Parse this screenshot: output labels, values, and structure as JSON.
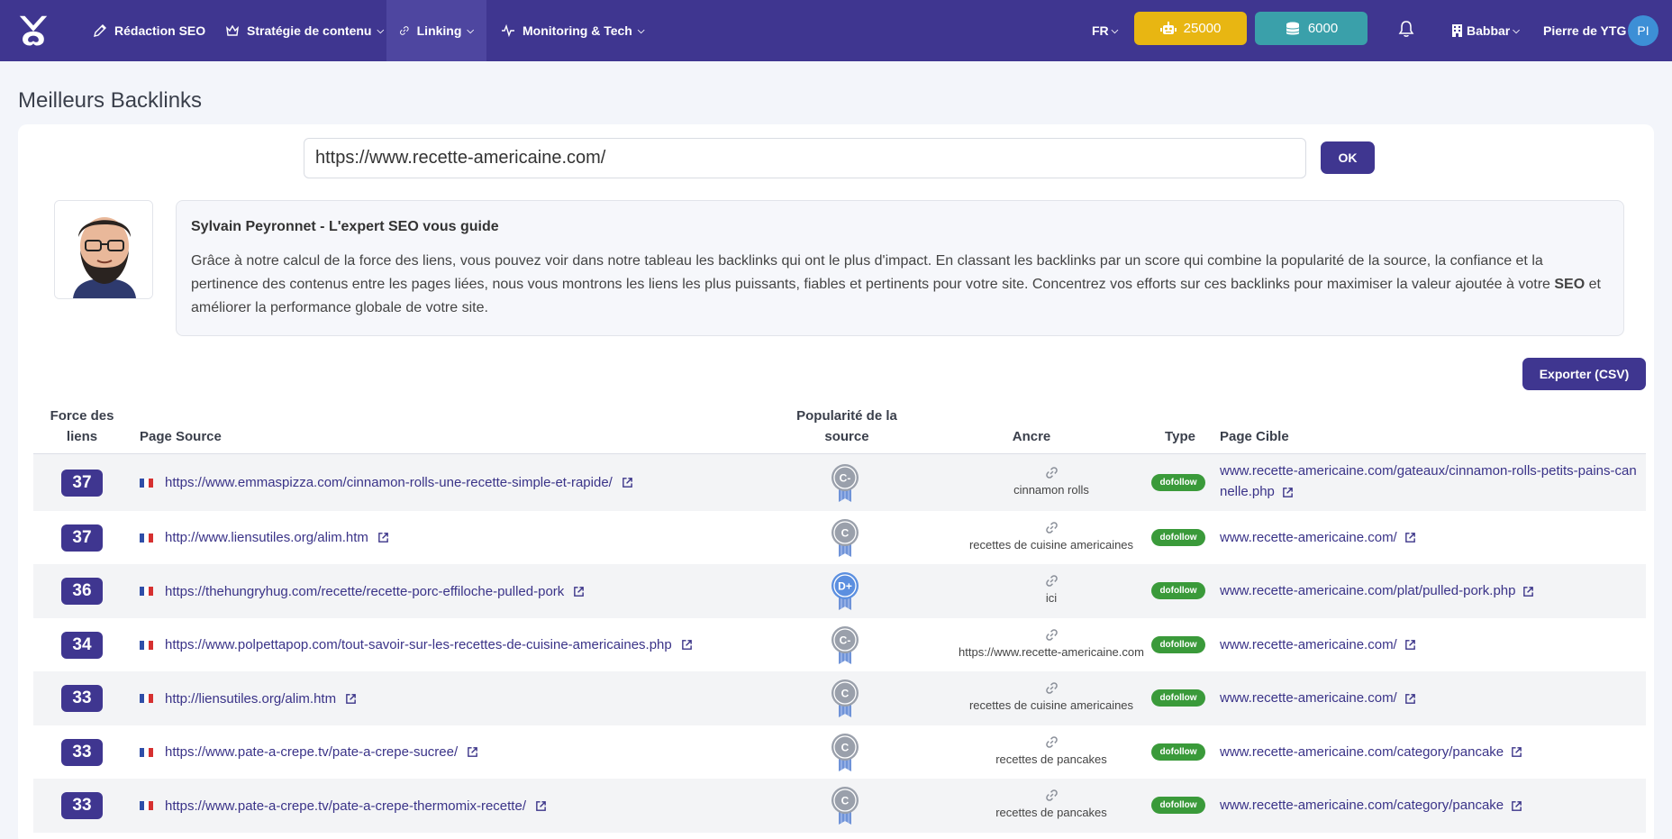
{
  "nav": {
    "items": [
      {
        "label": "Rédaction SEO",
        "icon": "pen-icon",
        "chevron": false
      },
      {
        "label": "Stratégie de contenu",
        "icon": "crown-icon",
        "chevron": true
      },
      {
        "label": "Linking",
        "icon": "link-icon",
        "chevron": true,
        "active": true
      },
      {
        "label": "Monitoring & Tech",
        "icon": "pulse-icon",
        "chevron": true
      }
    ],
    "lang": "FR",
    "credits_gold": "25000",
    "credits_teal": "6000",
    "workspace": "Babbar",
    "user_name": "Pierre de YTG",
    "user_initials": "PI"
  },
  "page": {
    "title": "Meilleurs Backlinks",
    "url_value": "https://www.recette-americaine.com/",
    "ok_label": "OK",
    "export_label": "Exporter (CSV)"
  },
  "guide": {
    "title": "Sylvain Peyronnet - L'expert SEO vous guide",
    "text_before": "Grâce à notre calcul de la force des liens, vous pouvez voir dans notre tableau les backlinks qui ont le plus d'impact. En classant les backlinks par un score qui combine la popularité de la source, la confiance et la pertinence des contenus entre les pages liées, nous vous montrons les liens les plus puissants, fiables et pertinents pour votre site. Concentrez vos efforts sur ces backlinks pour maximiser la valeur ajoutée à votre ",
    "text_bold": "SEO",
    "text_after": " et améliorer la performance globale de votre site."
  },
  "table": {
    "headers": {
      "force": "Force des liens",
      "source": "Page Source",
      "popularity": "Popularité de la source",
      "anchor": "Ancre",
      "type": "Type",
      "target": "Page Cible"
    },
    "rows": [
      {
        "force": "37",
        "source": "https://www.emmaspizza.com/cinnamon-rolls-une-recette-simple-et-rapide/",
        "grade": "C-",
        "grade_color": "#9aa0ab",
        "anchor": "cinnamon rolls",
        "type": "dofollow",
        "target": "www.recette-americaine.com/gateaux/cinnamon-rolls-petits-pains-cannelle.php"
      },
      {
        "force": "37",
        "source": "http://www.liensutiles.org/alim.htm",
        "grade": "C",
        "grade_color": "#9aa0ab",
        "anchor": "recettes de cuisine americaines",
        "type": "dofollow",
        "target": "www.recette-americaine.com/"
      },
      {
        "force": "36",
        "source": "https://thehungryhug.com/recette/recette-porc-effiloche-pulled-pork",
        "grade": "D+",
        "grade_color": "#5b8fe0",
        "anchor": "ici",
        "type": "dofollow",
        "target": "www.recette-americaine.com/plat/pulled-pork.php"
      },
      {
        "force": "34",
        "source": "https://www.polpettapop.com/tout-savoir-sur-les-recettes-de-cuisine-americaines.php",
        "grade": "C-",
        "grade_color": "#9aa0ab",
        "anchor": "https://www.recette-americaine.com",
        "type": "dofollow",
        "target": "www.recette-americaine.com/"
      },
      {
        "force": "33",
        "source": "http://liensutiles.org/alim.htm",
        "grade": "C",
        "grade_color": "#9aa0ab",
        "anchor": "recettes de cuisine americaines",
        "type": "dofollow",
        "target": "www.recette-americaine.com/"
      },
      {
        "force": "33",
        "source": "https://www.pate-a-crepe.tv/pate-a-crepe-sucree/",
        "grade": "C",
        "grade_color": "#9aa0ab",
        "anchor": "recettes de pancakes",
        "type": "dofollow",
        "target": "www.recette-americaine.com/category/pancake"
      },
      {
        "force": "33",
        "source": "https://www.pate-a-crepe.tv/pate-a-crepe-thermomix-recette/",
        "grade": "C",
        "grade_color": "#9aa0ab",
        "anchor": "recettes de pancakes",
        "type": "dofollow",
        "target": "www.recette-americaine.com/category/pancake"
      }
    ]
  }
}
